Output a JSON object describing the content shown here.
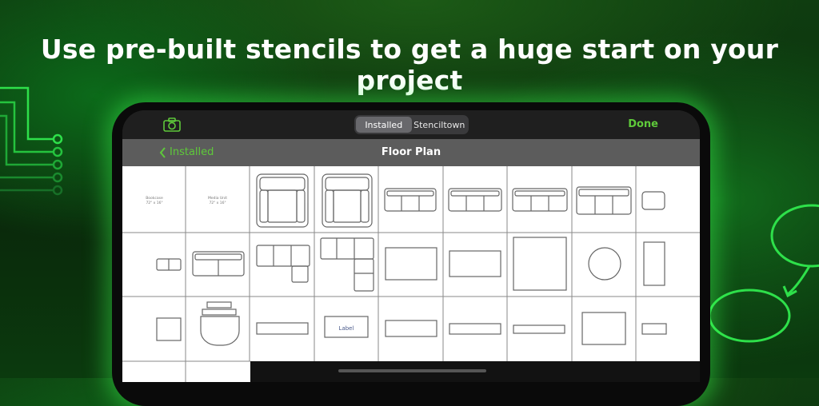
{
  "headline": "Use pre-built stencils to get a huge start on your project",
  "toolbar": {
    "camera_icon": "camera-icon",
    "segments": [
      "Installed",
      "Stenciltown"
    ],
    "selected_segment": "Installed",
    "done_label": "Done"
  },
  "navbar": {
    "back_label": "Installed",
    "title": "Floor Plan"
  },
  "stencils": {
    "bookcase": {
      "name": "Bookcase",
      "size": "72\" x 16\""
    },
    "media_unit": {
      "name": "Media Unit",
      "size": "72\" x 16\""
    },
    "label_text": "Label"
  },
  "colors": {
    "accent": "#5ec93a",
    "glow": "#3cff50",
    "background": "#0f3d10"
  }
}
